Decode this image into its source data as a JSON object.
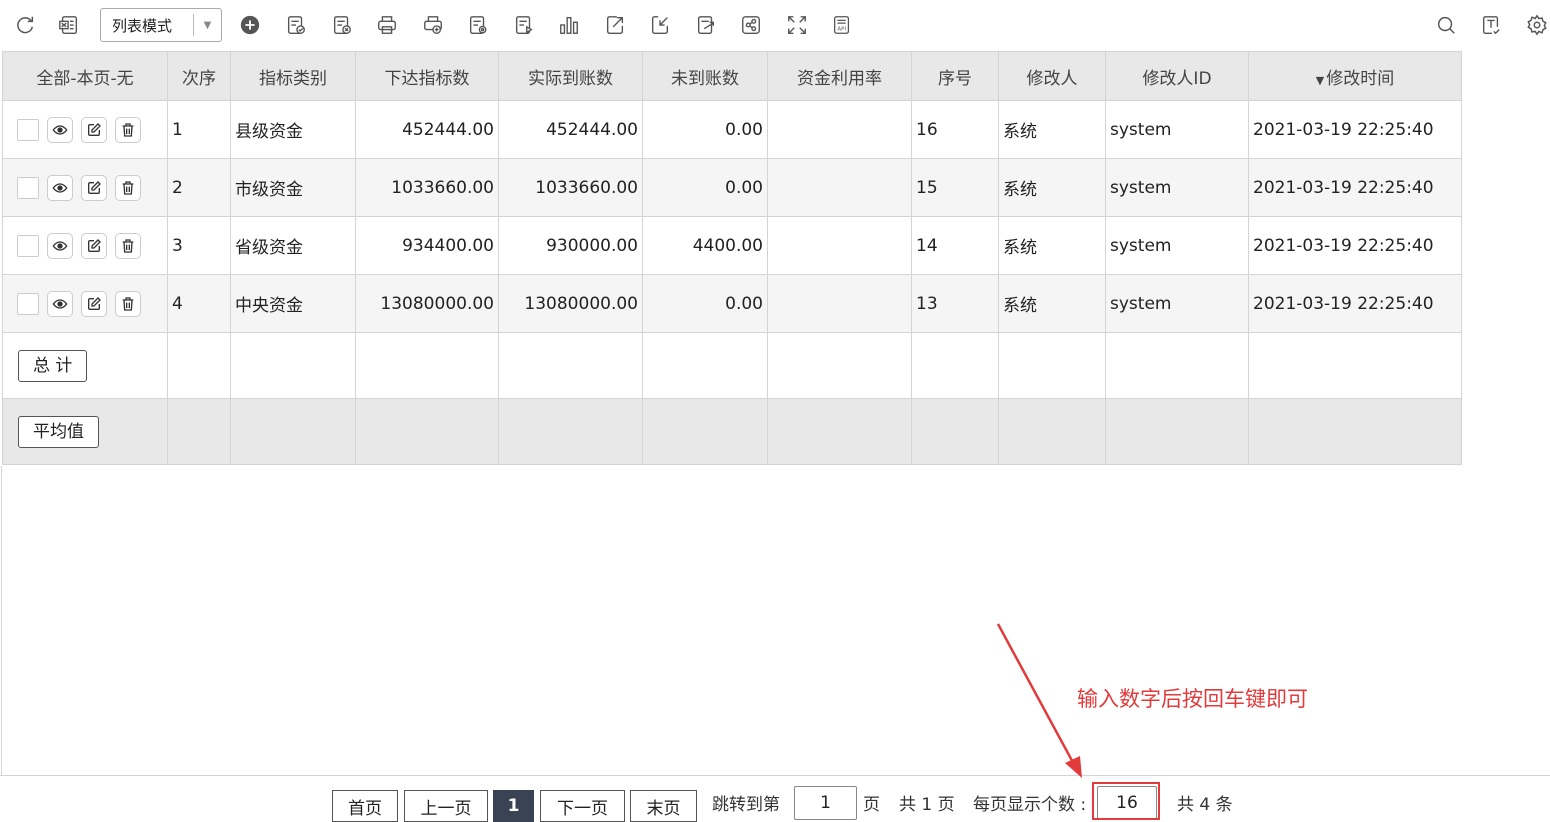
{
  "toolbar": {
    "mode_value": "列表模式",
    "icons": [
      "refresh-icon",
      "export-excel-icon",
      "add-icon",
      "approve-icon",
      "reject-icon",
      "print-icon",
      "print-add-icon",
      "print-settings-icon",
      "publish-icon",
      "chart-icon",
      "share-out-icon",
      "import-icon",
      "export-icon",
      "share-icon",
      "fullscreen-icon",
      "api-icon",
      "search-icon",
      "text-template-icon",
      "settings-icon"
    ]
  },
  "table": {
    "headers": {
      "select": "全部-本页-无",
      "order": "次序",
      "category": "指标类别",
      "issued": "下达指标数",
      "received": "实际到账数",
      "pending": "未到账数",
      "utilization": "资金利用率",
      "seq": "序号",
      "modifier": "修改人",
      "modifier_id": "修改人ID",
      "modified_time": "修改时间"
    },
    "rows": [
      {
        "order": "1",
        "category": "县级资金",
        "issued": "452444.00",
        "received": "452444.00",
        "pending": "0.00",
        "utilization": "",
        "seq": "16",
        "modifier": "系统",
        "modifier_id": "system",
        "modified_time": "2021-03-19 22:25:40"
      },
      {
        "order": "2",
        "category": "市级资金",
        "issued": "1033660.00",
        "received": "1033660.00",
        "pending": "0.00",
        "utilization": "",
        "seq": "15",
        "modifier": "系统",
        "modifier_id": "system",
        "modified_time": "2021-03-19 22:25:40"
      },
      {
        "order": "3",
        "category": "省级资金",
        "issued": "934400.00",
        "received": "930000.00",
        "pending": "4400.00",
        "utilization": "",
        "seq": "14",
        "modifier": "系统",
        "modifier_id": "system",
        "modified_time": "2021-03-19 22:25:40"
      },
      {
        "order": "4",
        "category": "中央资金",
        "issued": "13080000.00",
        "received": "13080000.00",
        "pending": "0.00",
        "utilization": "",
        "seq": "13",
        "modifier": "系统",
        "modifier_id": "system",
        "modified_time": "2021-03-19 22:25:40"
      }
    ],
    "total_label": "总 计",
    "average_label": "平均值"
  },
  "pager": {
    "first": "首页",
    "prev": "上一页",
    "current": "1",
    "next": "下一页",
    "last": "末页",
    "jump_label": "跳转到第",
    "jump_value": "1",
    "page_unit": "页",
    "total_pages": "共 1 页",
    "page_size_label": "每页显示个数 :",
    "page_size_value": "16",
    "total_records": "共 4 条"
  },
  "annotation": {
    "text": "输入数字后按回车键即可",
    "color": "#e23b3b"
  }
}
